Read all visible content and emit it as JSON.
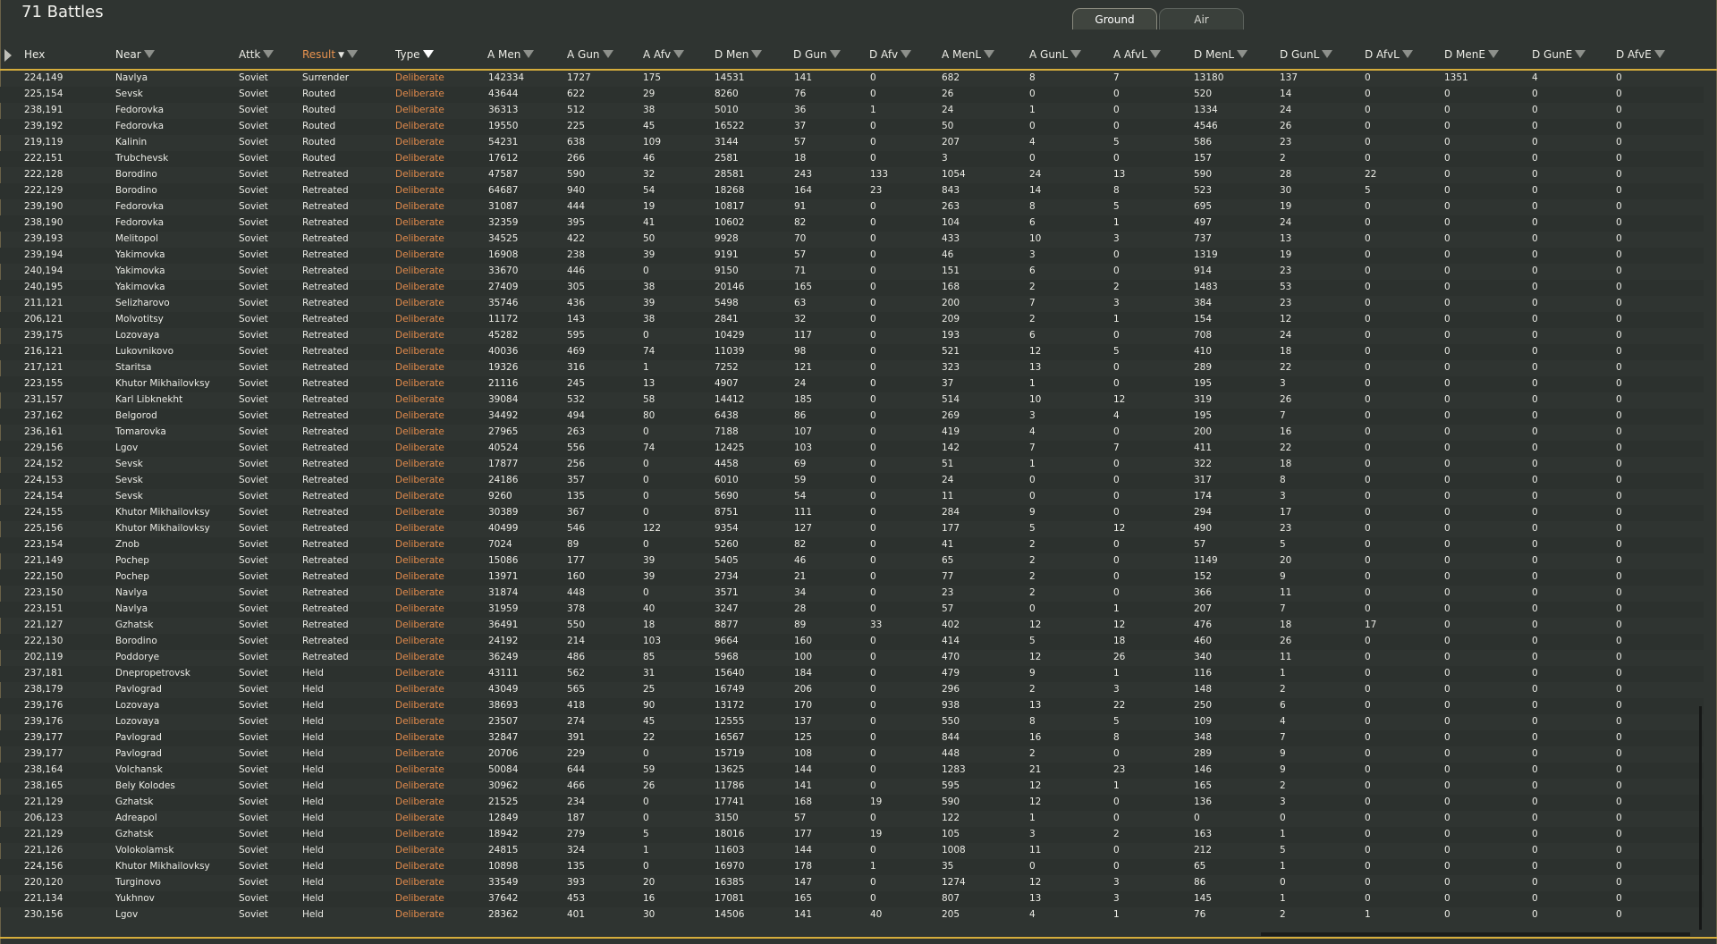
{
  "title": "71 Battles",
  "tabs": [
    {
      "label": "Ground",
      "active": true
    },
    {
      "label": "Air",
      "active": false
    }
  ],
  "colors": {
    "accent": "#d6ad3c",
    "type_text": "#e38b4c",
    "sorted_header": "#e8934f"
  },
  "columns": [
    "Hex",
    "Near",
    "Attk",
    "Result",
    "Type",
    "A Men",
    "A Gun",
    "A Afv",
    "D Men",
    "D Gun",
    "D Afv",
    "A MenL",
    "A GunL",
    "A AfvL",
    "D MenL",
    "D GunL",
    "D AfvL",
    "D MenE",
    "D GunE",
    "D AfvE"
  ],
  "rows": [
    [
      "224,149",
      "Navlya",
      "Soviet",
      "Surrender",
      "Deliberate",
      "142334",
      "1727",
      "175",
      "14531",
      "141",
      "0",
      "682",
      "8",
      "7",
      "13180",
      "137",
      "0",
      "1351",
      "4",
      "0"
    ],
    [
      "225,154",
      "Sevsk",
      "Soviet",
      "Routed",
      "Deliberate",
      "43644",
      "622",
      "29",
      "8260",
      "76",
      "0",
      "26",
      "0",
      "0",
      "520",
      "14",
      "0",
      "0",
      "0",
      "0"
    ],
    [
      "238,191",
      "Fedorovka",
      "Soviet",
      "Routed",
      "Deliberate",
      "36313",
      "512",
      "38",
      "5010",
      "36",
      "1",
      "24",
      "1",
      "0",
      "1334",
      "24",
      "0",
      "0",
      "0",
      "0"
    ],
    [
      "239,192",
      "Fedorovka",
      "Soviet",
      "Routed",
      "Deliberate",
      "19550",
      "225",
      "45",
      "16522",
      "37",
      "0",
      "50",
      "0",
      "0",
      "4546",
      "26",
      "0",
      "0",
      "0",
      "0"
    ],
    [
      "219,119",
      "Kalinin",
      "Soviet",
      "Routed",
      "Deliberate",
      "54231",
      "638",
      "109",
      "3144",
      "57",
      "0",
      "207",
      "4",
      "5",
      "586",
      "23",
      "0",
      "0",
      "0",
      "0"
    ],
    [
      "222,151",
      "Trubchevsk",
      "Soviet",
      "Routed",
      "Deliberate",
      "17612",
      "266",
      "46",
      "2581",
      "18",
      "0",
      "3",
      "0",
      "0",
      "157",
      "2",
      "0",
      "0",
      "0",
      "0"
    ],
    [
      "222,128",
      "Borodino",
      "Soviet",
      "Retreated",
      "Deliberate",
      "47587",
      "590",
      "32",
      "28581",
      "243",
      "133",
      "1054",
      "24",
      "13",
      "590",
      "28",
      "22",
      "0",
      "0",
      "0"
    ],
    [
      "222,129",
      "Borodino",
      "Soviet",
      "Retreated",
      "Deliberate",
      "64687",
      "940",
      "54",
      "18268",
      "164",
      "23",
      "843",
      "14",
      "8",
      "523",
      "30",
      "5",
      "0",
      "0",
      "0"
    ],
    [
      "239,190",
      "Fedorovka",
      "Soviet",
      "Retreated",
      "Deliberate",
      "31087",
      "444",
      "19",
      "10817",
      "91",
      "0",
      "263",
      "8",
      "5",
      "695",
      "19",
      "0",
      "0",
      "0",
      "0"
    ],
    [
      "238,190",
      "Fedorovka",
      "Soviet",
      "Retreated",
      "Deliberate",
      "32359",
      "395",
      "41",
      "10602",
      "82",
      "0",
      "104",
      "6",
      "1",
      "497",
      "24",
      "0",
      "0",
      "0",
      "0"
    ],
    [
      "239,193",
      "Melitopol",
      "Soviet",
      "Retreated",
      "Deliberate",
      "34525",
      "422",
      "50",
      "9928",
      "70",
      "0",
      "433",
      "10",
      "3",
      "737",
      "13",
      "0",
      "0",
      "0",
      "0"
    ],
    [
      "239,194",
      "Yakimovka",
      "Soviet",
      "Retreated",
      "Deliberate",
      "16908",
      "238",
      "39",
      "9191",
      "57",
      "0",
      "46",
      "3",
      "0",
      "1319",
      "19",
      "0",
      "0",
      "0",
      "0"
    ],
    [
      "240,194",
      "Yakimovka",
      "Soviet",
      "Retreated",
      "Deliberate",
      "33670",
      "446",
      "0",
      "9150",
      "71",
      "0",
      "151",
      "6",
      "0",
      "914",
      "23",
      "0",
      "0",
      "0",
      "0"
    ],
    [
      "240,195",
      "Yakimovka",
      "Soviet",
      "Retreated",
      "Deliberate",
      "27409",
      "305",
      "38",
      "20146",
      "165",
      "0",
      "168",
      "2",
      "2",
      "1483",
      "53",
      "0",
      "0",
      "0",
      "0"
    ],
    [
      "211,121",
      "Selizharovo",
      "Soviet",
      "Retreated",
      "Deliberate",
      "35746",
      "436",
      "39",
      "5498",
      "63",
      "0",
      "200",
      "7",
      "3",
      "384",
      "23",
      "0",
      "0",
      "0",
      "0"
    ],
    [
      "206,121",
      "Molvotitsy",
      "Soviet",
      "Retreated",
      "Deliberate",
      "11172",
      "143",
      "38",
      "2841",
      "32",
      "0",
      "209",
      "2",
      "1",
      "154",
      "12",
      "0",
      "0",
      "0",
      "0"
    ],
    [
      "239,175",
      "Lozovaya",
      "Soviet",
      "Retreated",
      "Deliberate",
      "45282",
      "595",
      "0",
      "10429",
      "117",
      "0",
      "193",
      "6",
      "0",
      "708",
      "24",
      "0",
      "0",
      "0",
      "0"
    ],
    [
      "216,121",
      "Lukovnikovo",
      "Soviet",
      "Retreated",
      "Deliberate",
      "40036",
      "469",
      "74",
      "11039",
      "98",
      "0",
      "521",
      "12",
      "5",
      "410",
      "18",
      "0",
      "0",
      "0",
      "0"
    ],
    [
      "217,121",
      "Staritsa",
      "Soviet",
      "Retreated",
      "Deliberate",
      "19326",
      "316",
      "1",
      "7252",
      "121",
      "0",
      "323",
      "13",
      "0",
      "289",
      "22",
      "0",
      "0",
      "0",
      "0"
    ],
    [
      "223,155",
      "Khutor Mikhailovksy",
      "Soviet",
      "Retreated",
      "Deliberate",
      "21116",
      "245",
      "13",
      "4907",
      "24",
      "0",
      "37",
      "1",
      "0",
      "195",
      "3",
      "0",
      "0",
      "0",
      "0"
    ],
    [
      "231,157",
      "Karl Libknekht",
      "Soviet",
      "Retreated",
      "Deliberate",
      "39084",
      "532",
      "58",
      "14412",
      "185",
      "0",
      "514",
      "10",
      "12",
      "319",
      "26",
      "0",
      "0",
      "0",
      "0"
    ],
    [
      "237,162",
      "Belgorod",
      "Soviet",
      "Retreated",
      "Deliberate",
      "34492",
      "494",
      "80",
      "6438",
      "86",
      "0",
      "269",
      "3",
      "4",
      "195",
      "7",
      "0",
      "0",
      "0",
      "0"
    ],
    [
      "236,161",
      "Tomarovka",
      "Soviet",
      "Retreated",
      "Deliberate",
      "27965",
      "263",
      "0",
      "7188",
      "107",
      "0",
      "419",
      "4",
      "0",
      "200",
      "16",
      "0",
      "0",
      "0",
      "0"
    ],
    [
      "229,156",
      "Lgov",
      "Soviet",
      "Retreated",
      "Deliberate",
      "40524",
      "556",
      "74",
      "12425",
      "103",
      "0",
      "142",
      "7",
      "7",
      "411",
      "22",
      "0",
      "0",
      "0",
      "0"
    ],
    [
      "224,152",
      "Sevsk",
      "Soviet",
      "Retreated",
      "Deliberate",
      "17877",
      "256",
      "0",
      "4458",
      "69",
      "0",
      "51",
      "1",
      "0",
      "322",
      "18",
      "0",
      "0",
      "0",
      "0"
    ],
    [
      "224,153",
      "Sevsk",
      "Soviet",
      "Retreated",
      "Deliberate",
      "24186",
      "357",
      "0",
      "6010",
      "59",
      "0",
      "24",
      "0",
      "0",
      "317",
      "8",
      "0",
      "0",
      "0",
      "0"
    ],
    [
      "224,154",
      "Sevsk",
      "Soviet",
      "Retreated",
      "Deliberate",
      "9260",
      "135",
      "0",
      "5690",
      "54",
      "0",
      "11",
      "0",
      "0",
      "174",
      "3",
      "0",
      "0",
      "0",
      "0"
    ],
    [
      "224,155",
      "Khutor Mikhailovksy",
      "Soviet",
      "Retreated",
      "Deliberate",
      "30389",
      "367",
      "0",
      "8751",
      "111",
      "0",
      "284",
      "9",
      "0",
      "294",
      "17",
      "0",
      "0",
      "0",
      "0"
    ],
    [
      "225,156",
      "Khutor Mikhailovksy",
      "Soviet",
      "Retreated",
      "Deliberate",
      "40499",
      "546",
      "122",
      "9354",
      "127",
      "0",
      "177",
      "5",
      "12",
      "490",
      "23",
      "0",
      "0",
      "0",
      "0"
    ],
    [
      "223,154",
      "Znob",
      "Soviet",
      "Retreated",
      "Deliberate",
      "7024",
      "89",
      "0",
      "5260",
      "82",
      "0",
      "41",
      "2",
      "0",
      "57",
      "5",
      "0",
      "0",
      "0",
      "0"
    ],
    [
      "221,149",
      "Pochep",
      "Soviet",
      "Retreated",
      "Deliberate",
      "15086",
      "177",
      "39",
      "5405",
      "46",
      "0",
      "65",
      "2",
      "0",
      "1149",
      "20",
      "0",
      "0",
      "0",
      "0"
    ],
    [
      "222,150",
      "Pochep",
      "Soviet",
      "Retreated",
      "Deliberate",
      "13971",
      "160",
      "39",
      "2734",
      "21",
      "0",
      "77",
      "2",
      "0",
      "152",
      "9",
      "0",
      "0",
      "0",
      "0"
    ],
    [
      "223,150",
      "Navlya",
      "Soviet",
      "Retreated",
      "Deliberate",
      "31874",
      "448",
      "0",
      "3571",
      "34",
      "0",
      "23",
      "2",
      "0",
      "366",
      "11",
      "0",
      "0",
      "0",
      "0"
    ],
    [
      "223,151",
      "Navlya",
      "Soviet",
      "Retreated",
      "Deliberate",
      "31959",
      "378",
      "40",
      "3247",
      "28",
      "0",
      "57",
      "0",
      "1",
      "207",
      "7",
      "0",
      "0",
      "0",
      "0"
    ],
    [
      "221,127",
      "Gzhatsk",
      "Soviet",
      "Retreated",
      "Deliberate",
      "36491",
      "550",
      "18",
      "8877",
      "89",
      "33",
      "402",
      "12",
      "12",
      "476",
      "18",
      "17",
      "0",
      "0",
      "0"
    ],
    [
      "222,130",
      "Borodino",
      "Soviet",
      "Retreated",
      "Deliberate",
      "24192",
      "214",
      "103",
      "9664",
      "160",
      "0",
      "414",
      "5",
      "18",
      "460",
      "26",
      "0",
      "0",
      "0",
      "0"
    ],
    [
      "202,119",
      "Poddorye",
      "Soviet",
      "Retreated",
      "Deliberate",
      "36249",
      "486",
      "85",
      "5968",
      "100",
      "0",
      "470",
      "12",
      "26",
      "340",
      "11",
      "0",
      "0",
      "0",
      "0"
    ],
    [
      "237,181",
      "Dnepropetrovsk",
      "Soviet",
      "Held",
      "Deliberate",
      "43111",
      "562",
      "31",
      "15640",
      "184",
      "0",
      "479",
      "9",
      "1",
      "116",
      "1",
      "0",
      "0",
      "0",
      "0"
    ],
    [
      "238,179",
      "Pavlograd",
      "Soviet",
      "Held",
      "Deliberate",
      "43049",
      "565",
      "25",
      "16749",
      "206",
      "0",
      "296",
      "2",
      "3",
      "148",
      "2",
      "0",
      "0",
      "0",
      "0"
    ],
    [
      "239,176",
      "Lozovaya",
      "Soviet",
      "Held",
      "Deliberate",
      "38693",
      "418",
      "90",
      "13172",
      "170",
      "0",
      "938",
      "13",
      "22",
      "250",
      "6",
      "0",
      "0",
      "0",
      "0"
    ],
    [
      "239,176",
      "Lozovaya",
      "Soviet",
      "Held",
      "Deliberate",
      "23507",
      "274",
      "45",
      "12555",
      "137",
      "0",
      "550",
      "8",
      "5",
      "109",
      "4",
      "0",
      "0",
      "0",
      "0"
    ],
    [
      "239,177",
      "Pavlograd",
      "Soviet",
      "Held",
      "Deliberate",
      "32847",
      "391",
      "22",
      "16567",
      "125",
      "0",
      "844",
      "16",
      "8",
      "348",
      "7",
      "0",
      "0",
      "0",
      "0"
    ],
    [
      "239,177",
      "Pavlograd",
      "Soviet",
      "Held",
      "Deliberate",
      "20706",
      "229",
      "0",
      "15719",
      "108",
      "0",
      "448",
      "2",
      "0",
      "289",
      "9",
      "0",
      "0",
      "0",
      "0"
    ],
    [
      "238,164",
      "Volchansk",
      "Soviet",
      "Held",
      "Deliberate",
      "50084",
      "644",
      "59",
      "13625",
      "144",
      "0",
      "1283",
      "21",
      "23",
      "146",
      "9",
      "0",
      "0",
      "0",
      "0"
    ],
    [
      "238,165",
      "Bely Kolodes",
      "Soviet",
      "Held",
      "Deliberate",
      "30962",
      "466",
      "26",
      "11786",
      "141",
      "0",
      "595",
      "12",
      "1",
      "165",
      "2",
      "0",
      "0",
      "0",
      "0"
    ],
    [
      "221,129",
      "Gzhatsk",
      "Soviet",
      "Held",
      "Deliberate",
      "21525",
      "234",
      "0",
      "17741",
      "168",
      "19",
      "590",
      "12",
      "0",
      "136",
      "3",
      "0",
      "0",
      "0",
      "0"
    ],
    [
      "206,123",
      "Adreapol",
      "Soviet",
      "Held",
      "Deliberate",
      "12849",
      "187",
      "0",
      "3150",
      "57",
      "0",
      "122",
      "1",
      "0",
      "0",
      "0",
      "0",
      "0",
      "0",
      "0"
    ],
    [
      "221,129",
      "Gzhatsk",
      "Soviet",
      "Held",
      "Deliberate",
      "18942",
      "279",
      "5",
      "18016",
      "177",
      "19",
      "105",
      "3",
      "2",
      "163",
      "1",
      "0",
      "0",
      "0",
      "0"
    ],
    [
      "221,126",
      "Volokolamsk",
      "Soviet",
      "Held",
      "Deliberate",
      "24815",
      "324",
      "1",
      "11603",
      "144",
      "0",
      "1008",
      "11",
      "0",
      "212",
      "5",
      "0",
      "0",
      "0",
      "0"
    ],
    [
      "224,156",
      "Khutor Mikhailovksy",
      "Soviet",
      "Held",
      "Deliberate",
      "10898",
      "135",
      "0",
      "16970",
      "178",
      "1",
      "35",
      "0",
      "0",
      "65",
      "1",
      "0",
      "0",
      "0",
      "0"
    ],
    [
      "220,120",
      "Turginovo",
      "Soviet",
      "Held",
      "Deliberate",
      "33549",
      "393",
      "20",
      "16385",
      "147",
      "0",
      "1274",
      "12",
      "3",
      "86",
      "0",
      "0",
      "0",
      "0",
      "0"
    ],
    [
      "221,134",
      "Yukhnov",
      "Soviet",
      "Held",
      "Deliberate",
      "37642",
      "453",
      "16",
      "17081",
      "165",
      "0",
      "807",
      "13",
      "3",
      "145",
      "1",
      "0",
      "0",
      "0",
      "0"
    ],
    [
      "230,156",
      "Lgov",
      "Soviet",
      "Held",
      "Deliberate",
      "28362",
      "401",
      "30",
      "14506",
      "141",
      "40",
      "205",
      "4",
      "1",
      "76",
      "2",
      "1",
      "0",
      "0",
      "0"
    ]
  ]
}
